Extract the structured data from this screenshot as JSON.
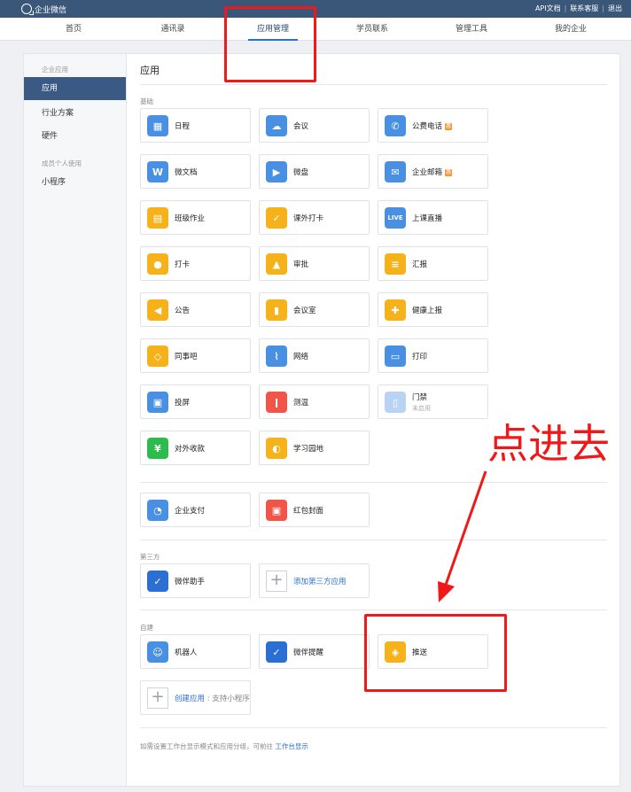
{
  "topbar": {
    "logo_text": "企业微信",
    "links": [
      "API文档",
      "联系客服",
      "退出"
    ]
  },
  "nav": [
    "首页",
    "通讯录",
    "应用管理",
    "学员联系",
    "管理工具",
    "我的企业"
  ],
  "sidebar": {
    "group1": "企业应用",
    "items1": [
      "应用",
      "行业方案",
      "硬件"
    ],
    "group2": "成员个人使用",
    "items2": [
      "小程序"
    ]
  },
  "content": {
    "title": "应用",
    "section_basic": "基础",
    "basic": [
      {
        "name": "日程",
        "icon": "calendar-icon",
        "color": "#4a90e2"
      },
      {
        "name": "会议",
        "icon": "cloud-meeting-icon",
        "color": "#4a90e2"
      },
      {
        "name": "公费电话",
        "icon": "phone-icon",
        "color": "#4a90e2",
        "tag": "惠"
      },
      {
        "name": "微文档",
        "icon": "document-w-icon",
        "color": "#4a90e2"
      },
      {
        "name": "微盘",
        "icon": "drive-icon",
        "color": "#4a90e2"
      },
      {
        "name": "企业邮箱",
        "icon": "mail-icon",
        "color": "#4a90e2",
        "tag": "惠"
      },
      {
        "name": "班级作业",
        "icon": "homework-icon",
        "color": "#f5b21b"
      },
      {
        "name": "课外打卡",
        "icon": "checkin-card-icon",
        "color": "#f5b21b"
      },
      {
        "name": "上课直播",
        "icon": "live-icon",
        "color": "#4a90e2"
      },
      {
        "name": "打卡",
        "icon": "location-pin-icon",
        "color": "#f5b21b"
      },
      {
        "name": "审批",
        "icon": "stamp-icon",
        "color": "#f5b21b"
      },
      {
        "name": "汇报",
        "icon": "report-icon",
        "color": "#f5b21b"
      },
      {
        "name": "公告",
        "icon": "megaphone-icon",
        "color": "#f5b21b"
      },
      {
        "name": "会议室",
        "icon": "door-icon",
        "color": "#f5b21b"
      },
      {
        "name": "健康上报",
        "icon": "health-icon",
        "color": "#f5b21b"
      },
      {
        "name": "同事吧",
        "icon": "colleague-icon",
        "color": "#f5b21b"
      },
      {
        "name": "网络",
        "icon": "router-icon",
        "color": "#4a90e2"
      },
      {
        "name": "打印",
        "icon": "printer-icon",
        "color": "#4a90e2"
      },
      {
        "name": "投屏",
        "icon": "screen-cast-icon",
        "color": "#4a90e2"
      },
      {
        "name": "测温",
        "icon": "thermometer-icon",
        "color": "#f0554a"
      },
      {
        "name": "门禁",
        "icon": "access-control-icon",
        "color": "#b9d3f4",
        "sub": "未启用"
      },
      {
        "name": "对外收款",
        "icon": "payment-yen-icon",
        "color": "#2dbb4e"
      },
      {
        "name": "学习园地",
        "icon": "planet-icon",
        "color": "#f5b21b"
      }
    ],
    "pay": [
      {
        "name": "企业支付",
        "icon": "enterprise-pay-icon",
        "color": "#4a90e2"
      },
      {
        "name": "红包封面",
        "icon": "red-packet-icon",
        "color": "#f0554a"
      }
    ],
    "section_third": "第三方",
    "third": [
      {
        "name": "微伴助手",
        "icon": "weiban-icon",
        "color": "#2b6fd3"
      },
      {
        "name": "添加第三方应用",
        "icon": "plus-icon",
        "color": "#ffffff"
      }
    ],
    "section_custom": "自建",
    "custom": [
      {
        "name": "机器人",
        "icon": "robot-icon",
        "color": "#4a90e2"
      },
      {
        "name": "微伴提醒",
        "icon": "weiban-reminder-icon",
        "color": "#2b6fd3"
      },
      {
        "name": "推送",
        "icon": "push-icon",
        "color": "#f5b21b"
      }
    ],
    "create_app": "创建应用",
    "create_app_hint": "支持小程序",
    "footer_text": "如需设置工作台显示模式和应用分组，可前往",
    "footer_link": "工作台显示"
  },
  "annotation": {
    "text": "点进去",
    "color": "#f01818"
  }
}
